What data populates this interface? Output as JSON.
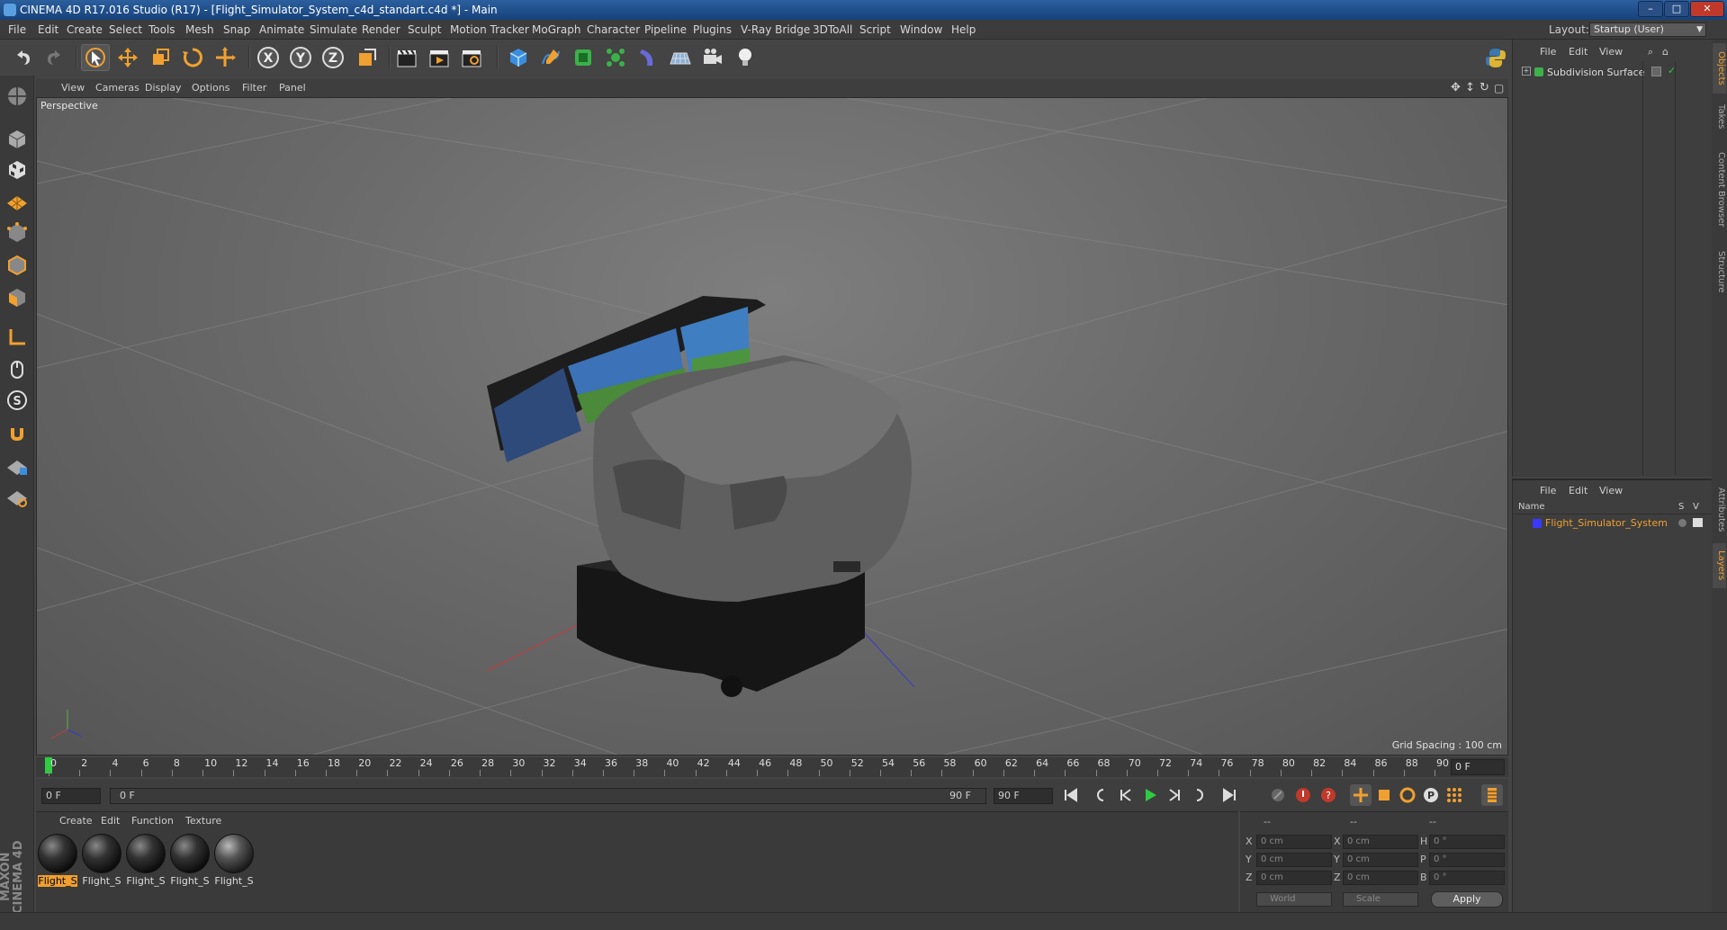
{
  "window": {
    "title": "CINEMA 4D R17.016 Studio (R17) - [Flight_Simulator_System_c4d_standart.c4d *] - Main",
    "controls": [
      "–",
      "□",
      "✕"
    ]
  },
  "menu": {
    "items": [
      "File",
      "Edit",
      "Create",
      "Select",
      "Tools",
      "Mesh",
      "Snap",
      "Animate",
      "Simulate",
      "Render",
      "Sculpt",
      "Motion Tracker",
      "MoGraph",
      "Character",
      "Pipeline",
      "Plugins",
      "V-Ray Bridge",
      "3DToAll",
      "Script",
      "Window",
      "Help"
    ],
    "layout_label": "Layout:",
    "layout_value": "Startup (User)"
  },
  "toolbar": {
    "axis_x": "X",
    "axis_y": "Y",
    "axis_z": "Z",
    "accent": "#f0a030"
  },
  "viewport": {
    "menu": [
      "View",
      "Cameras",
      "Display",
      "Options",
      "Filter",
      "Panel"
    ],
    "label": "Perspective",
    "grid_spacing": "Grid Spacing : 100 cm"
  },
  "timeline": {
    "ticks": [
      "0",
      "2",
      "4",
      "6",
      "8",
      "10",
      "12",
      "14",
      "16",
      "18",
      "20",
      "22",
      "24",
      "26",
      "28",
      "30",
      "32",
      "34",
      "36",
      "38",
      "40",
      "42",
      "44",
      "46",
      "48",
      "50",
      "52",
      "54",
      "56",
      "58",
      "60",
      "62",
      "64",
      "66",
      "68",
      "70",
      "72",
      "74",
      "76",
      "78",
      "80",
      "82",
      "84",
      "86",
      "88",
      "90"
    ],
    "current_frame": "0 F",
    "start_field": "0 F",
    "range_start": "0 F",
    "range_end": "90 F",
    "end_field": "90 F"
  },
  "materials": {
    "menu": [
      "Create",
      "Edit",
      "Function",
      "Texture"
    ],
    "items": [
      "Flight_S",
      "Flight_S",
      "Flight_S",
      "Flight_S",
      "Flight_S"
    ]
  },
  "coords": {
    "header": [
      "--",
      "--",
      "--"
    ],
    "rows": [
      {
        "axis": "X",
        "pos": "0 cm",
        "axis2": "X",
        "size": "0 cm",
        "rot_label": "H",
        "rot": "0 °"
      },
      {
        "axis": "Y",
        "pos": "0 cm",
        "axis2": "Y",
        "size": "0 cm",
        "rot_label": "P",
        "rot": "0 °"
      },
      {
        "axis": "Z",
        "pos": "0 cm",
        "axis2": "Z",
        "size": "0 cm",
        "rot_label": "B",
        "rot": "0 °"
      }
    ],
    "mode1": "World",
    "mode2": "Scale",
    "apply": "Apply"
  },
  "objects": {
    "menu": [
      "File",
      "Edit",
      "View"
    ],
    "items": [
      {
        "name": "Subdivision Surface"
      }
    ]
  },
  "layers": {
    "menu": [
      "File",
      "Edit",
      "View"
    ],
    "col_name": "Name",
    "col_s": "S",
    "col_v": "V",
    "items": [
      {
        "name": "Flight_Simulator_System",
        "color": "#3a3aff"
      }
    ]
  },
  "right_tabs": [
    "Objects",
    "Takes",
    "Content Browser",
    "Structure",
    "Attributes",
    "Layers"
  ],
  "branding": "MAXON CINEMA 4D"
}
